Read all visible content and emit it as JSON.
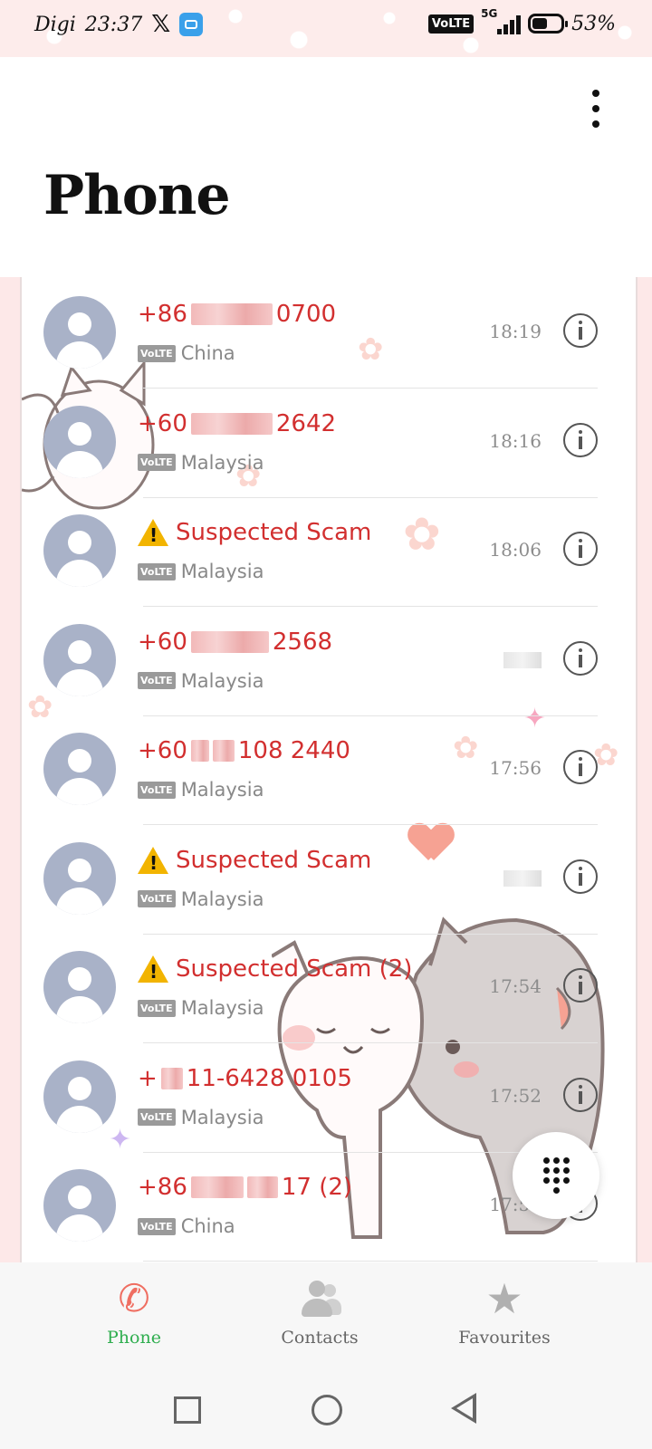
{
  "status_bar": {
    "carrier": "Digi",
    "time": "23:37",
    "volte": "VoLTE",
    "network": "5G",
    "battery": "53%"
  },
  "header": {
    "title": "Phone",
    "menu_icon": "more-vert-icon"
  },
  "calls": [
    {
      "prefix": "+86",
      "suffix": "0700",
      "name": "",
      "location": "China",
      "badge": "VoLTE",
      "time": "18:19",
      "type": "number"
    },
    {
      "prefix": "+60",
      "suffix": "2642",
      "name": "",
      "location": "Malaysia",
      "badge": "VoLTE",
      "time": "18:16",
      "type": "number"
    },
    {
      "prefix": "",
      "suffix": "",
      "name": "Suspected Scam",
      "location": "Malaysia",
      "badge": "VoLTE",
      "time": "18:06",
      "type": "scam"
    },
    {
      "prefix": "+60",
      "suffix": "2568",
      "name": "",
      "location": "Malaysia",
      "badge": "VoLTE",
      "time": "",
      "type": "number"
    },
    {
      "prefix": "+60",
      "suffix": "108 2440",
      "name": "",
      "location": "Malaysia",
      "badge": "VoLTE",
      "time": "17:56",
      "type": "number"
    },
    {
      "prefix": "",
      "suffix": "",
      "name": "Suspected Scam",
      "location": "Malaysia",
      "badge": "VoLTE",
      "time": "",
      "type": "scam"
    },
    {
      "prefix": "",
      "suffix": "",
      "name": "Suspected Scam (2)",
      "location": "Malaysia",
      "badge": "VoLTE",
      "time": "17:54",
      "type": "scam"
    },
    {
      "prefix": "+",
      "suffix": "11-6428 0105",
      "name": "",
      "location": "Malaysia",
      "badge": "VoLTE",
      "time": "17:52",
      "type": "number"
    },
    {
      "prefix": "+86",
      "suffix": "17 (2)",
      "name": "",
      "location": "China",
      "badge": "VoLTE",
      "time": "17:50",
      "type": "number"
    }
  ],
  "fab": {
    "icon": "dialpad-icon"
  },
  "bottom_nav": {
    "items": [
      {
        "label": "Phone",
        "icon": "phone-icon",
        "active": true,
        "color": "#2fae4f"
      },
      {
        "label": "Contacts",
        "icon": "contacts-icon",
        "active": false,
        "color": "#666666"
      },
      {
        "label": "Favourites",
        "icon": "star-icon",
        "active": false,
        "color": "#666666"
      }
    ]
  },
  "colors": {
    "caller_red": "#d22f2f",
    "accent_green": "#2fae4f",
    "avatar_bg": "#a9b2c8"
  }
}
